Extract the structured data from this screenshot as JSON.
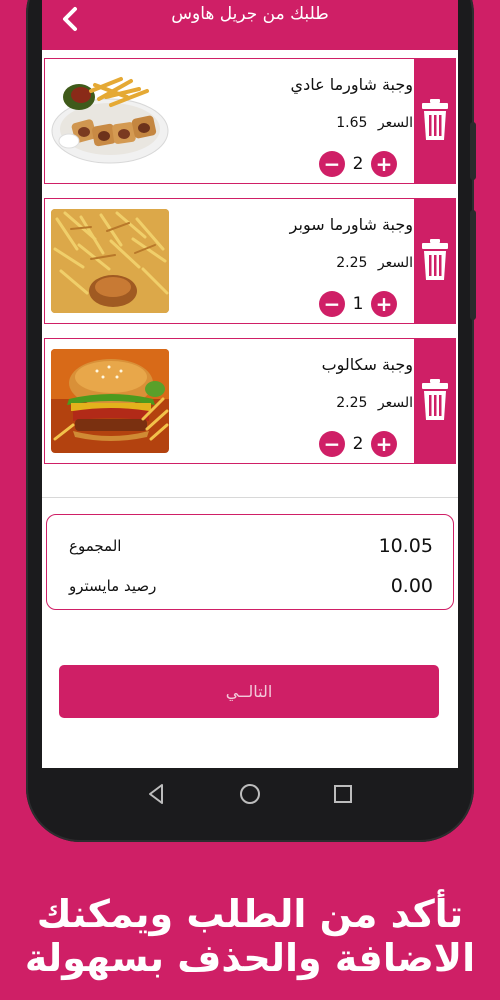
{
  "colors": {
    "brand": "#cf1f66",
    "background": "#cf1f66",
    "card_border": "#cf1f66",
    "text": "#111111"
  },
  "header": {
    "title": "طلبك من جريل هاوس",
    "back_icon": "chevron-left-icon"
  },
  "items": [
    {
      "name": "وجبة شاورما عادي",
      "price_label": "السعر",
      "price": "1.65",
      "quantity": "2",
      "image": "shawarma-plate-photo"
    },
    {
      "name": "وجبة شاورما سوبر",
      "price_label": "السعر",
      "price": "2.25",
      "quantity": "1",
      "image": "fries-box-photo"
    },
    {
      "name": "وجبة سكالوب",
      "price_label": "السعر",
      "price": "2.25",
      "quantity": "2",
      "image": "burger-photo"
    }
  ],
  "summary": {
    "total_label": "المجموع",
    "total_value": "10.05",
    "balance_label": "رصيد مايسترو",
    "balance_value": "0.00"
  },
  "next_button": "التالــي",
  "caption": {
    "line1": "تأكد من الطلب ويمكنك",
    "line2": "الاضافة والحذف بسهولة"
  },
  "nav": {
    "back": "triangle-back-icon",
    "home": "circle-home-icon",
    "recent": "square-recent-icon"
  }
}
